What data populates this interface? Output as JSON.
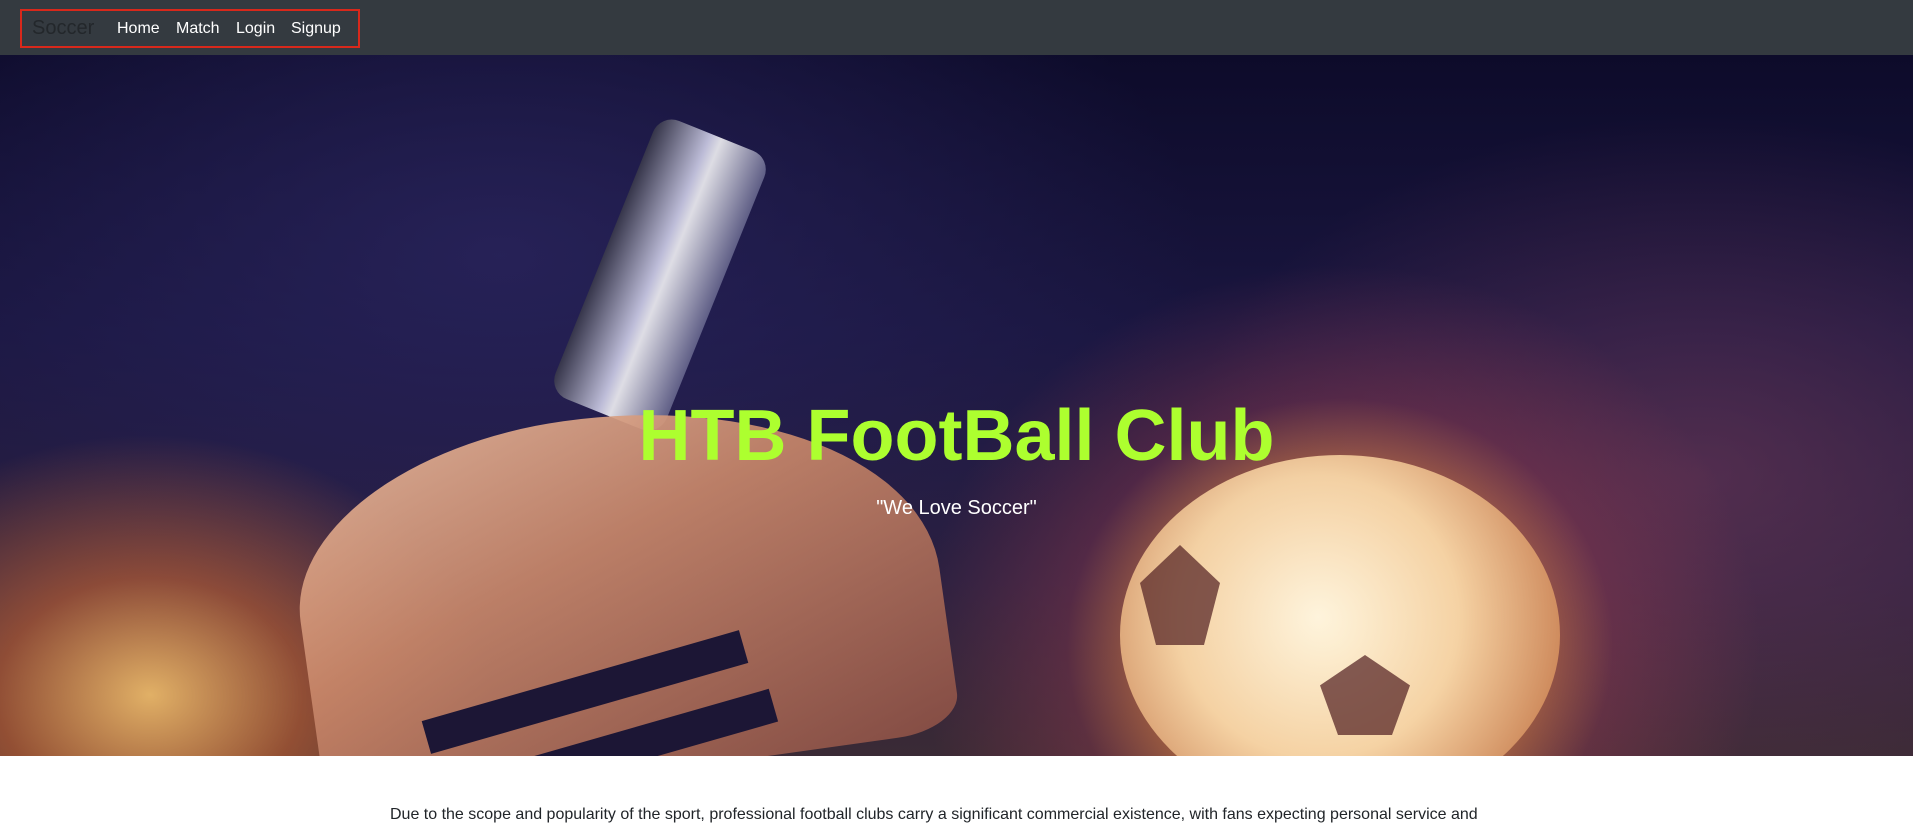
{
  "navbar": {
    "brand": "Soccer",
    "links": [
      {
        "label": "Home"
      },
      {
        "label": "Match"
      },
      {
        "label": "Login"
      },
      {
        "label": "Signup"
      }
    ],
    "highlight_color": "#d8281b",
    "background": "#343a40"
  },
  "hero": {
    "title": "HTB FootBall Club",
    "subtitle": "\"We Love Soccer\"",
    "title_color": "#adff2f"
  },
  "content": {
    "paragraph": "Due to the scope and popularity of the sport, professional football clubs carry a significant commercial existence, with fans expecting personal service and"
  }
}
